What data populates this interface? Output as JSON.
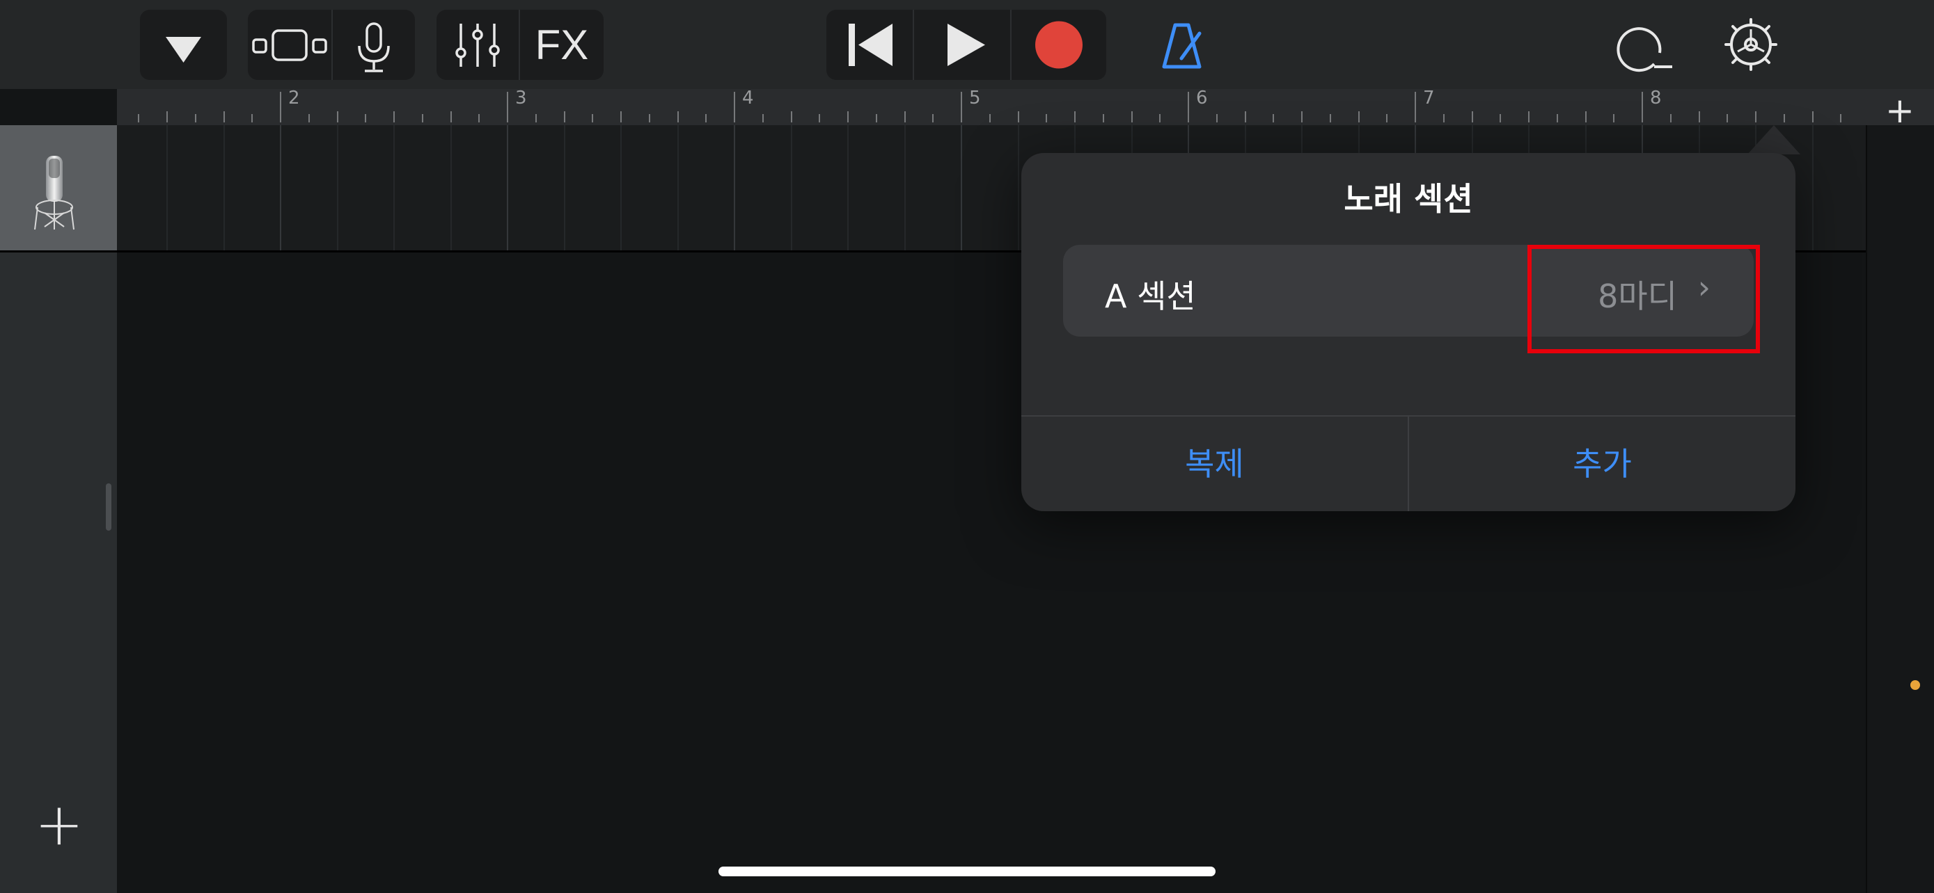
{
  "toolbar": {
    "view_menu_icon": "triangle-down-icon",
    "browser_icon": "track-view-icon",
    "instrument_icon": "microphone-icon",
    "mixer_icon": "sliders-icon",
    "fx_label": "FX",
    "rewind_icon": "go-to-beginning-icon",
    "play_icon": "play-icon",
    "record_icon": "record-icon",
    "metronome_icon": "metronome-icon",
    "loop_icon": "loop-icon",
    "settings_icon": "gear-icon"
  },
  "ruler": {
    "bars": [
      "2",
      "3",
      "4",
      "5",
      "6",
      "7",
      "8"
    ],
    "add_section_label": "+"
  },
  "sidebar": {
    "add_track_label": "+"
  },
  "popover": {
    "title": "노래 섹션",
    "section_row": {
      "label": "A 섹션",
      "value": "8마디",
      "chevron": "›"
    },
    "buttons": {
      "duplicate": "복제",
      "add": "추가"
    }
  },
  "colors": {
    "accent": "#3e8ef7",
    "record": "#e0443a",
    "highlight": "#e8000b",
    "metronome": "#3e8ef7"
  }
}
